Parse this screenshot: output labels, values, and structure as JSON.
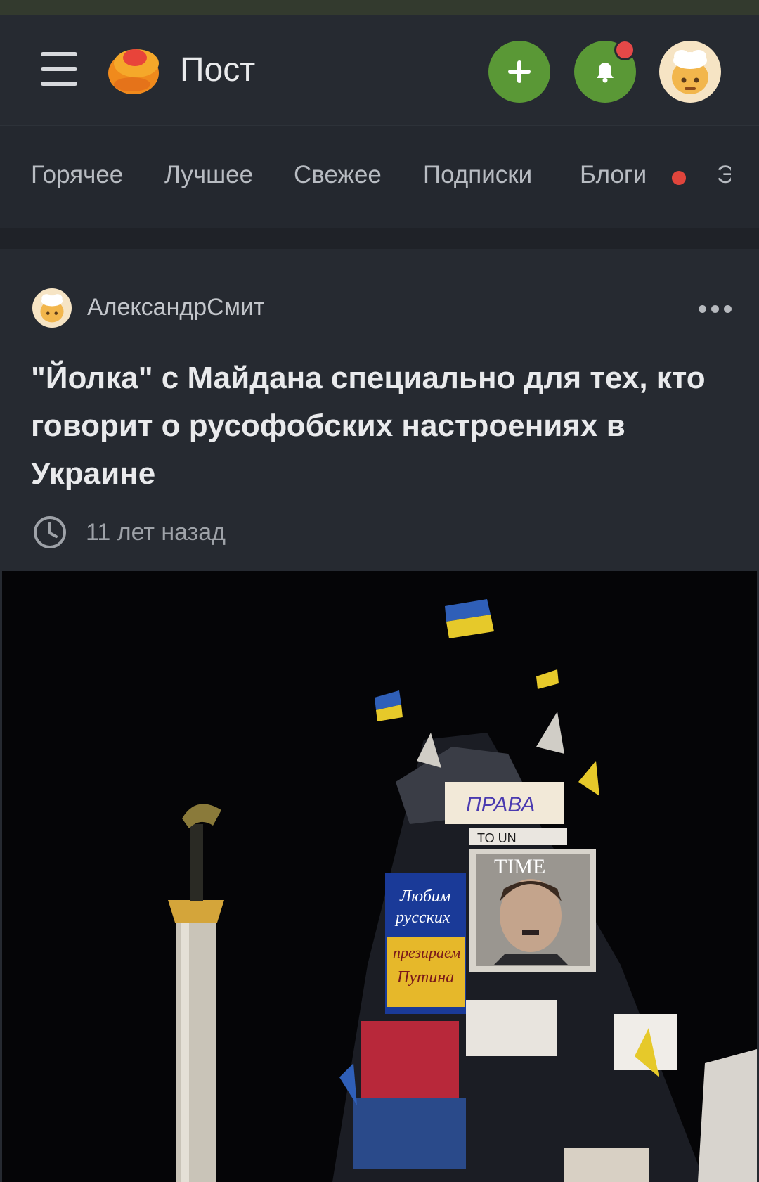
{
  "app": {
    "title": "Пост",
    "accent_color": "#5a9836",
    "notification_dot_color": "#e54848"
  },
  "header": {
    "menu_icon": "hamburger-menu-icon",
    "logo_icon": "app-logo-icon",
    "add_icon": "plus-icon",
    "bell_icon": "bell-icon",
    "avatar_icon": "user-avatar"
  },
  "tabs": [
    {
      "label": "Горячее"
    },
    {
      "label": "Лучшее"
    },
    {
      "label": "Свежее"
    },
    {
      "label": "Подписки"
    },
    {
      "label": "Блоги",
      "has_dot": true
    },
    {
      "label": "Э"
    }
  ],
  "post": {
    "author": "АлександрСмит",
    "title": "\"Йолка\" с Майдана специально для тех, кто говорит о русофобских настроениях в Украине",
    "time": "11 лет назад",
    "image_alt": "Photo: Christmas tree frame on Maidan at night covered with flags and posters, next to the Independence Monument column",
    "poster_texts": [
      "Любим русских",
      "презираем Путина",
      "TIME",
      "ПРАВА",
      "TO UN"
    ]
  }
}
